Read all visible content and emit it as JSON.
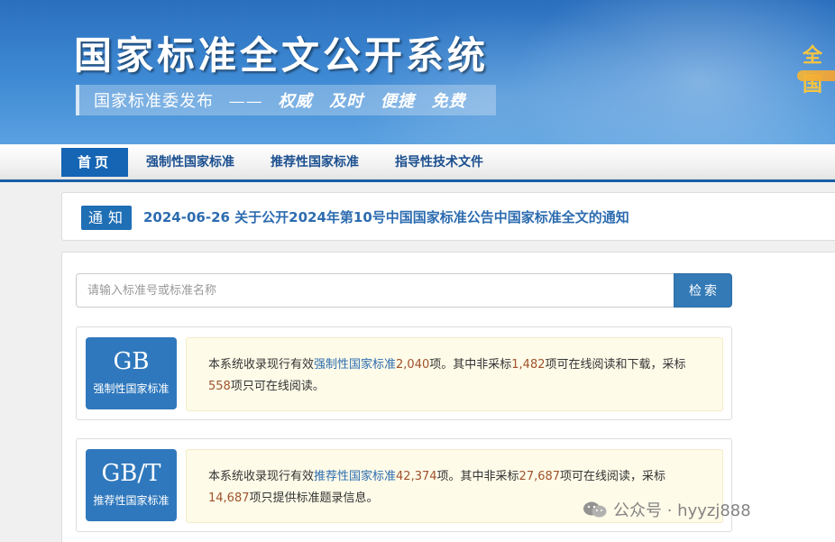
{
  "banner": {
    "title": "国家标准全文公开系统",
    "slogan_prefix": "国家标准委发布",
    "slogan_dash": "——",
    "slogan_keywords": [
      "权威",
      "及时",
      "便捷",
      "免费"
    ],
    "corner_text": "全国"
  },
  "nav": {
    "items": [
      {
        "label": "首页"
      },
      {
        "label": "强制性国家标准"
      },
      {
        "label": "推荐性国家标准"
      },
      {
        "label": "指导性技术文件"
      }
    ]
  },
  "notice": {
    "badge": "通知",
    "text": "2024-06-26  关于公开2024年第10号中国国家标准公告中国家标准全文的通知"
  },
  "search": {
    "placeholder": "请输入标准号或标准名称",
    "button": "检索"
  },
  "cards": [
    {
      "code": "GB",
      "category": "强制性国家标准",
      "t1": "本系统收录现行有效",
      "link": "强制性国家标准",
      "total": "2,040",
      "t2": "项。其中非采标",
      "non_adopted": "1,482",
      "t3": "项可在线阅读和下载，采标",
      "adopted": "558",
      "t4": "项只可在线阅读。"
    },
    {
      "code": "GB/T",
      "category": "推荐性国家标准",
      "t1": "本系统收录现行有效",
      "link": "推荐性国家标准",
      "total": "42,374",
      "t2": "项。其中非采标",
      "non_adopted": "27,687",
      "t3": "项可在线阅读，采标",
      "adopted": "14,687",
      "t4": "项只提供标准题录信息。"
    }
  ],
  "watermark": {
    "text": "公众号 · hyyzj888"
  }
}
